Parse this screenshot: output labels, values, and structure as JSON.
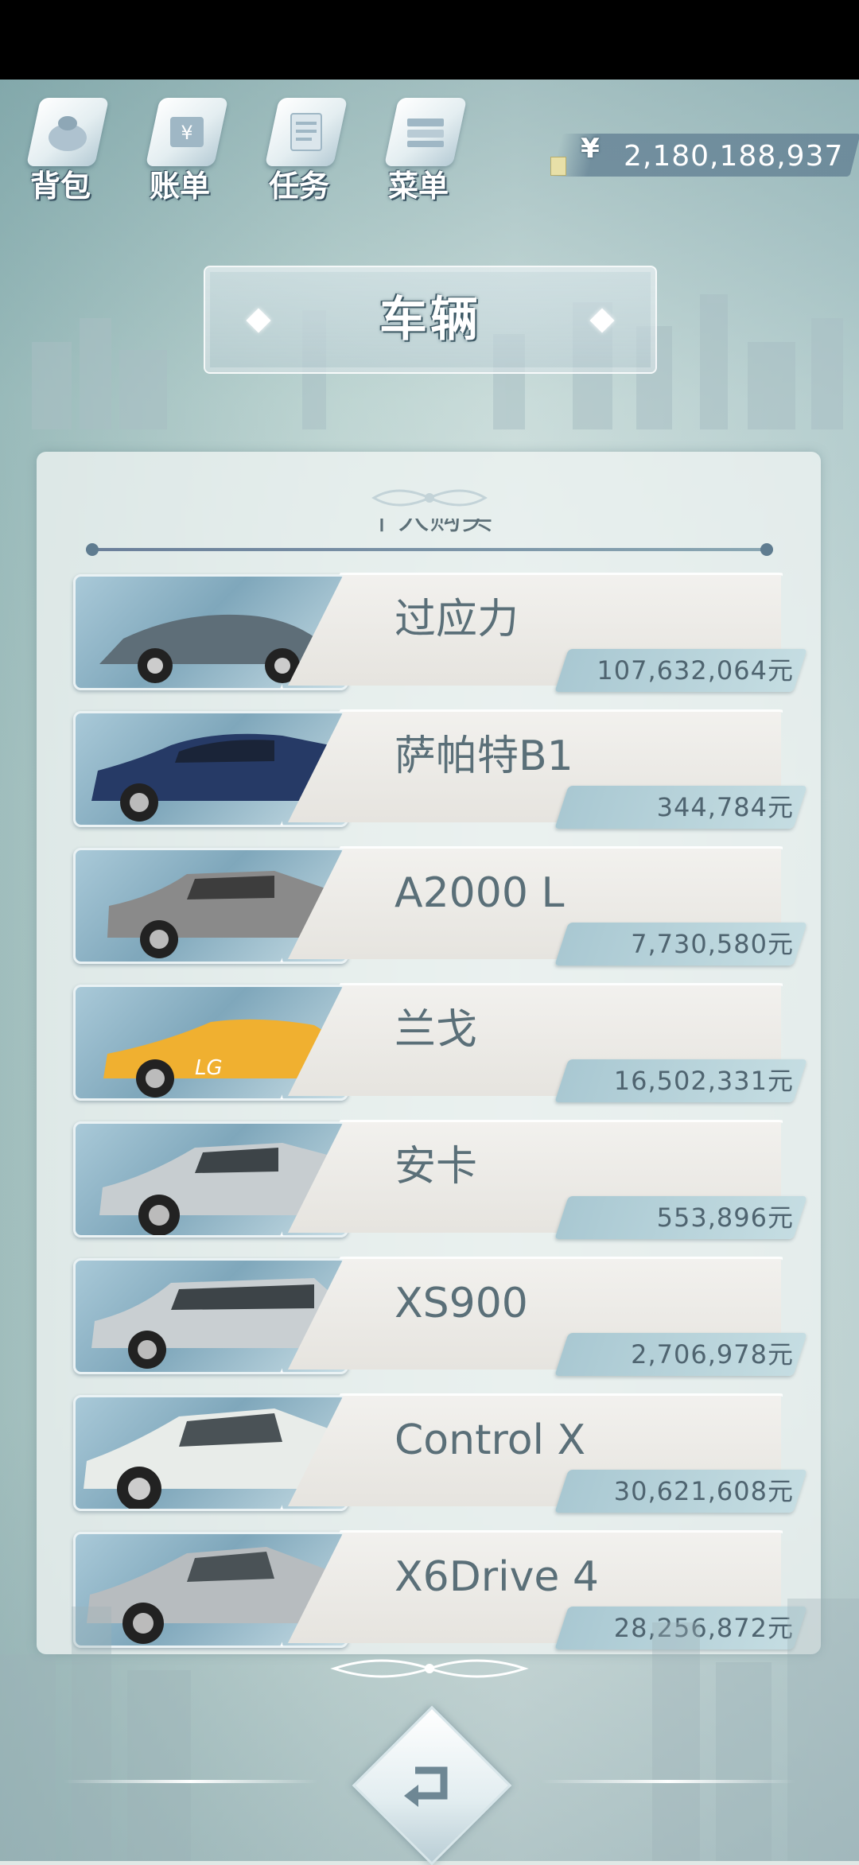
{
  "nav": [
    {
      "label": "背包",
      "icon": "bag-icon"
    },
    {
      "label": "账单",
      "icon": "bill-icon"
    },
    {
      "label": "任务",
      "icon": "task-icon"
    },
    {
      "label": "菜单",
      "icon": "menu-icon"
    }
  ],
  "currency": {
    "symbol": "¥",
    "amount": "2,180,188,937",
    "icon": "yen-icon"
  },
  "title": "车辆",
  "tab_partial": "个人购买",
  "vehicles": [
    {
      "name": "过应力",
      "price": "107,632,064元",
      "car_color": "#5e6e78"
    },
    {
      "name": "萨帕特B1",
      "price": "344,784元",
      "car_color": "#263a66"
    },
    {
      "name": "A2000 L",
      "price": "7,730,580元",
      "car_color": "#8a8a8a"
    },
    {
      "name": "兰戈",
      "price": "16,502,331元",
      "car_color": "#f0b030"
    },
    {
      "name": "安卡",
      "price": "553,896元",
      "car_color": "#c7cdd0"
    },
    {
      "name": "XS900",
      "price": "2,706,978元",
      "car_color": "#c9cfd2"
    },
    {
      "name": "Control X",
      "price": "30,621,608元",
      "car_color": "#e8ece9"
    },
    {
      "name": "X6Drive 4",
      "price": "28,256,872元",
      "car_color": "#b7bcbf"
    }
  ],
  "back_icon": "back-arrow-icon"
}
